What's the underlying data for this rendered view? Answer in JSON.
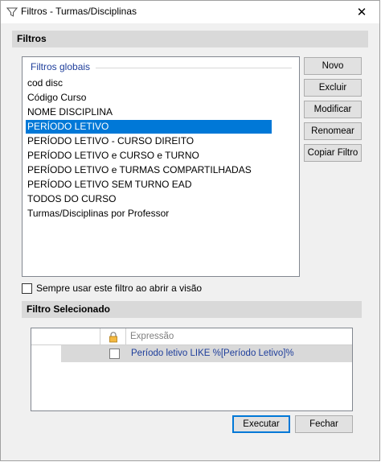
{
  "window": {
    "title": "Filtros - Turmas/Disciplinas",
    "close_glyph": "✕"
  },
  "filters_group": {
    "header": "Filtros",
    "list_group_label": "Filtros globais",
    "items": [
      {
        "label": "cod disc",
        "selected": false
      },
      {
        "label": "Código Curso",
        "selected": false
      },
      {
        "label": "NOME DISCIPLINA",
        "selected": false
      },
      {
        "label": "PERÍODO LETIVO",
        "selected": true
      },
      {
        "label": "PERÍODO LETIVO - CURSO DIREITO",
        "selected": false
      },
      {
        "label": "PERÍODO LETIVO e CURSO e TURNO",
        "selected": false
      },
      {
        "label": "PERÍODO LETIVO e TURMAS COMPARTILHADAS",
        "selected": false
      },
      {
        "label": "PERÍODO LETIVO SEM TURNO EAD",
        "selected": false
      },
      {
        "label": "TODOS DO CURSO",
        "selected": false
      },
      {
        "label": "Turmas/Disciplinas por Professor",
        "selected": false
      }
    ],
    "buttons": {
      "new": "Novo",
      "delete": "Excluir",
      "modify": "Modificar",
      "rename": "Renomear",
      "copy": "Copiar Filtro"
    },
    "always_use_checkbox": {
      "label": "Sempre usar este filtro ao abrir a visão",
      "checked": false
    }
  },
  "selected_filter_group": {
    "header": "Filtro Selecionado",
    "grid": {
      "column_header": "Expressão",
      "rows": [
        {
          "expression": "Período letivo LIKE %[Período Letivo]%",
          "locked": false
        }
      ]
    },
    "buttons": {
      "execute": "Executar",
      "close": "Fechar"
    }
  },
  "colors": {
    "selection": "#0078d7",
    "group_label_blue": "#1e3e9b",
    "group_header_bg": "#d9d9d9",
    "window_bg": "#f0f0f0"
  },
  "icons": {
    "title": "funnel-icon",
    "lock_column": "lock-icon"
  }
}
